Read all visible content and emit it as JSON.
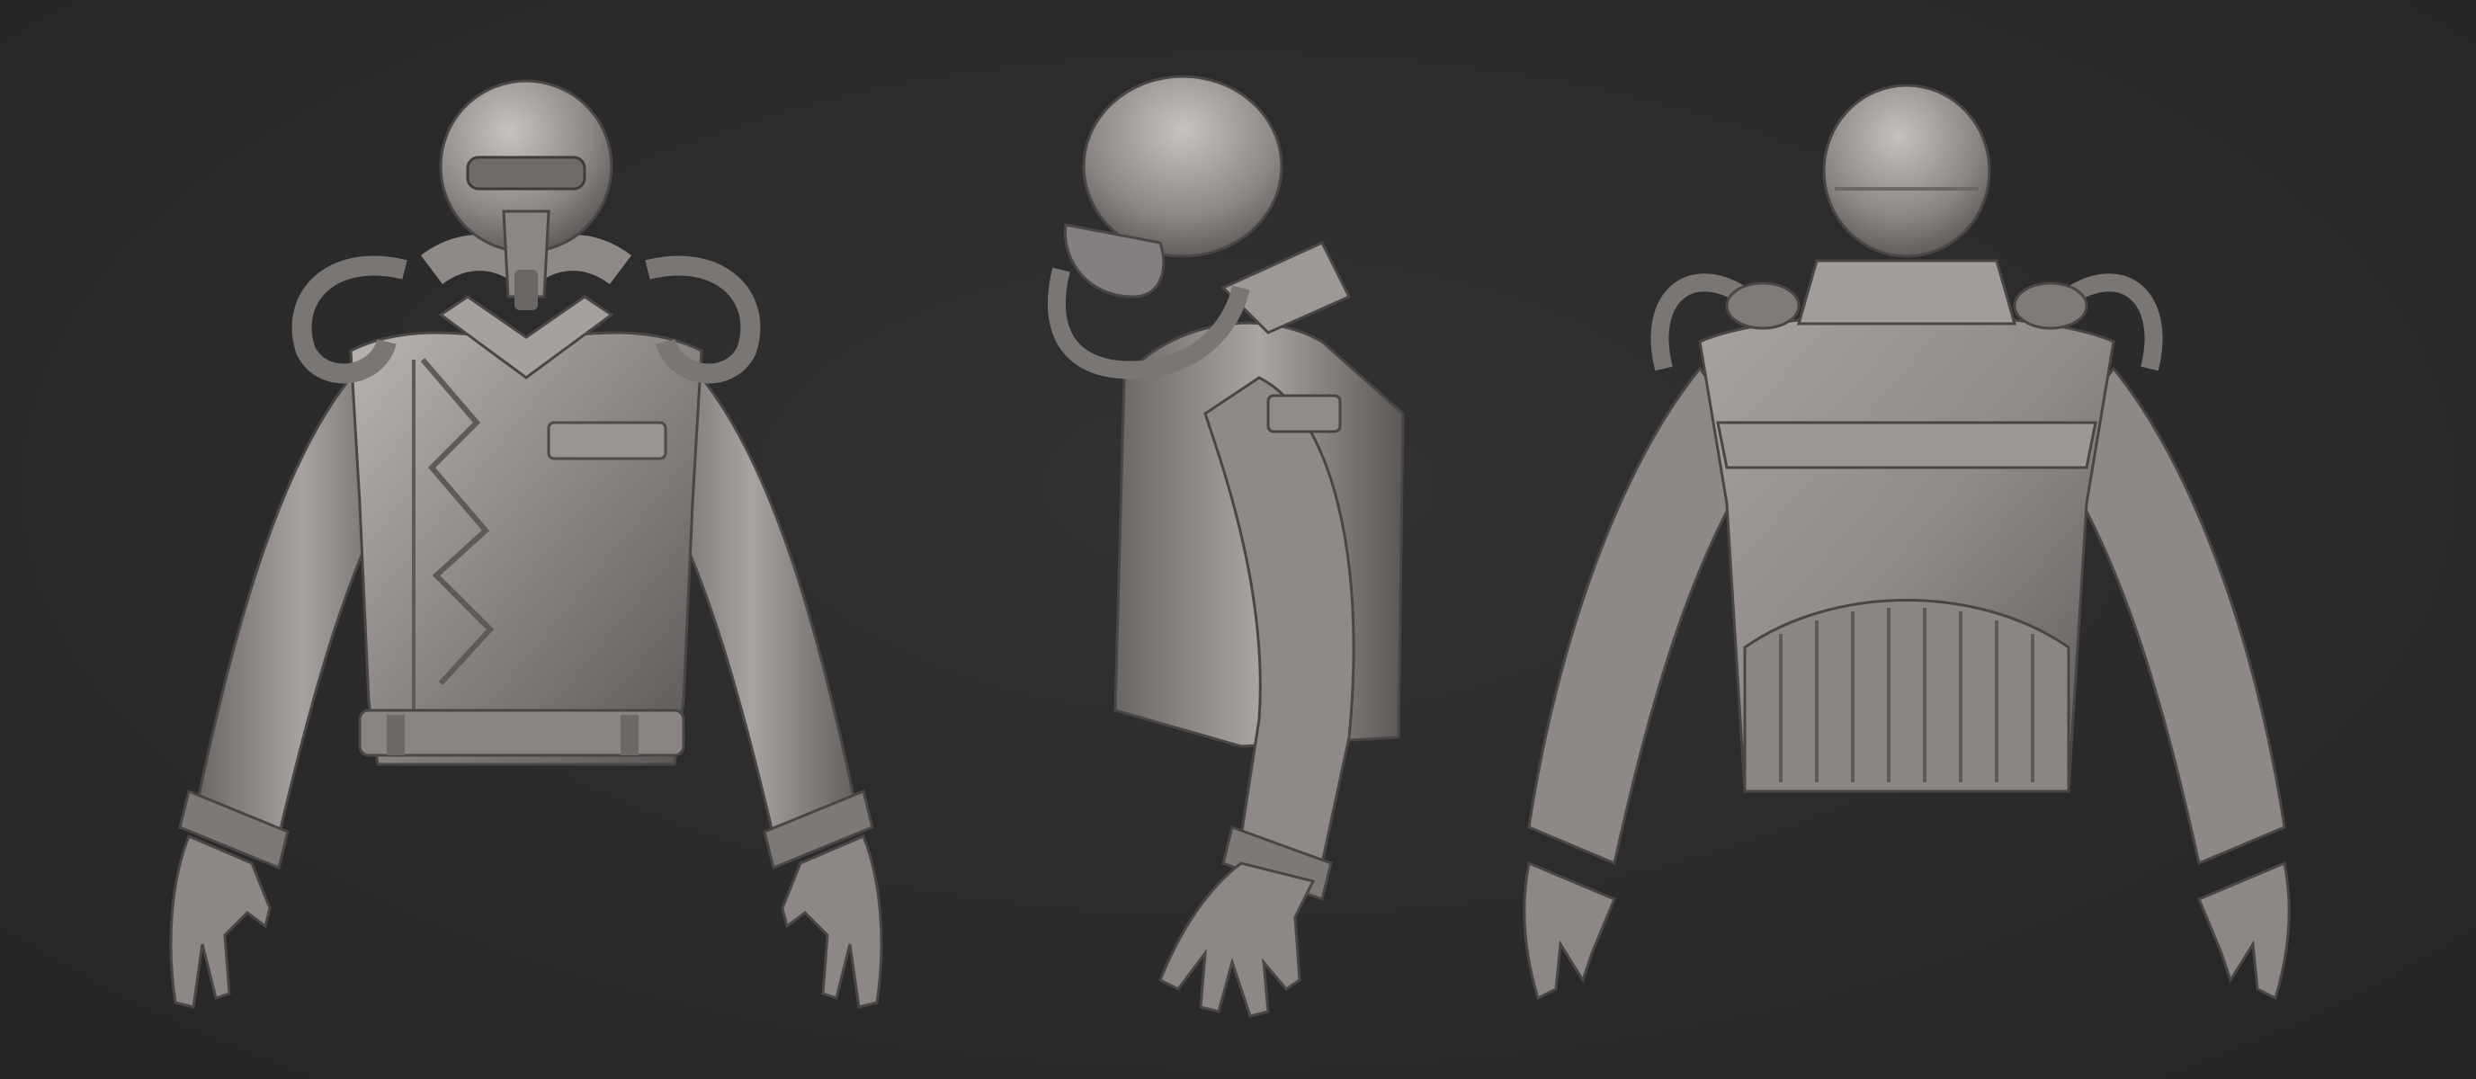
{
  "scene": {
    "background_color": "#2b2b2b",
    "material_color": "#8f8a88",
    "material_highlight": "#c9c4c1",
    "material_shadow": "#4e4a49",
    "views": [
      {
        "name": "front-view",
        "subject": "jacket-with-helmet-and-respirator"
      },
      {
        "name": "side-view",
        "subject": "jacket-with-helmet-and-respirator"
      },
      {
        "name": "back-view",
        "subject": "jacket-with-helmet-and-respirator"
      }
    ]
  }
}
